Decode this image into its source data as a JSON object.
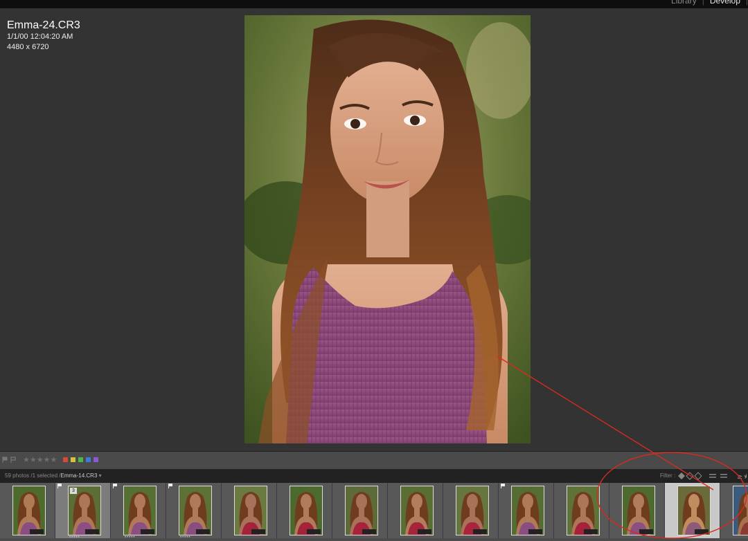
{
  "modules": {
    "library": "Library",
    "develop": "Develop"
  },
  "image_info": {
    "filename": "Emma-24.CR3",
    "datetime": "1/1/00 12:04:20 AM",
    "dimensions": "4480 x 6720"
  },
  "toolbar": {
    "stars": "★★★★★"
  },
  "color_labels": [
    "#d64a3a",
    "#d6c23a",
    "#4fb54a",
    "#3f7bd6",
    "#8a5ad6"
  ],
  "filmstrip": {
    "count_prefix": "59 photos /1 selected /",
    "current_file": "Emma-14.CR3",
    "dropdown": "▾",
    "filter_label": "Filter :",
    "stack_count": "3"
  },
  "thumbnails": [
    {
      "top": "#4f6b2c",
      "mid": "#b07a55",
      "bottom": "#8a4e82"
    },
    {
      "top": "#5a6e35",
      "mid": "#ad7658",
      "bottom": "#8d4e84"
    },
    {
      "top": "#567034",
      "mid": "#b17957",
      "bottom": "#8b4f82"
    },
    {
      "top": "#5b7136",
      "mid": "#ae7a57",
      "bottom": "#8a4d80"
    },
    {
      "top": "#6a7a40",
      "mid": "#a8715a",
      "bottom": "#a5233a"
    },
    {
      "top": "#4d6a2e",
      "mid": "#b07b5b",
      "bottom": "#a32439"
    },
    {
      "top": "#5d6b38",
      "mid": "#a87258",
      "bottom": "#a7233c"
    },
    {
      "top": "#586e33",
      "mid": "#b27d5c",
      "bottom": "#a4243b"
    },
    {
      "top": "#66763f",
      "mid": "#a97258",
      "bottom": "#a9243d"
    },
    {
      "top": "#556c33",
      "mid": "#b07a57",
      "bottom": "#8b4e83"
    },
    {
      "top": "#5f7339",
      "mid": "#ad7659",
      "bottom": "#a6223a"
    },
    {
      "top": "#4e6a2f",
      "mid": "#b07c5a",
      "bottom": "#8c4f84"
    },
    {
      "top": "#6a6a3b",
      "mid": "#c08c60",
      "bottom": "#8e5a7a"
    },
    {
      "top": "#3c5a7a",
      "mid": "#a7704e",
      "bottom": "#8a3a30"
    }
  ]
}
